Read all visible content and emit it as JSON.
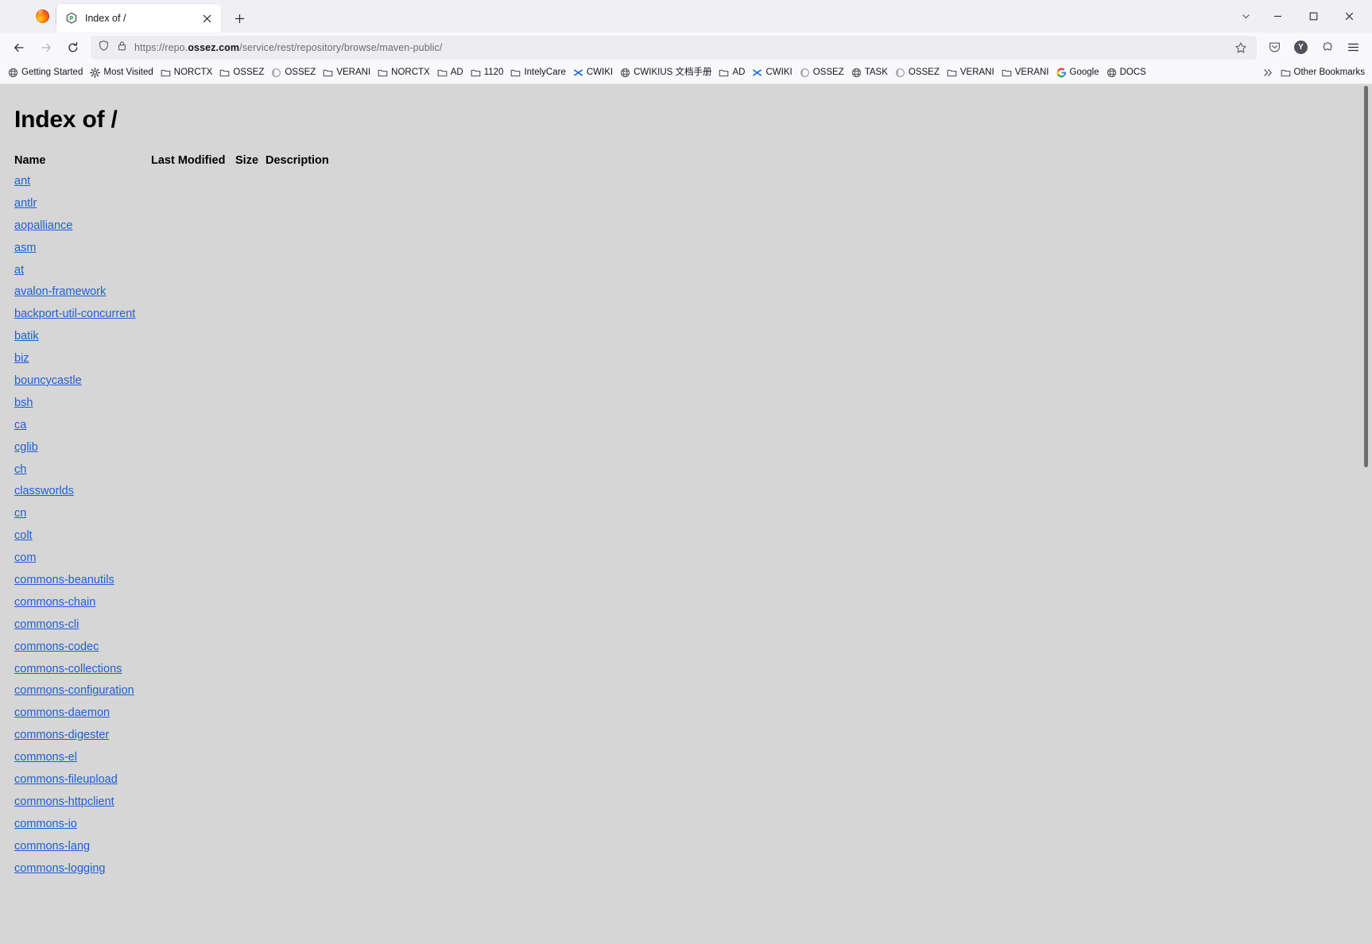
{
  "window": {
    "controls": {
      "tab_list_label": "List all tabs",
      "minimize_label": "Minimize",
      "maximize_label": "Maximize",
      "close_label": "Close"
    }
  },
  "tabstrip": {
    "tabs": [
      {
        "title": "Index of /",
        "favicon": "package-icon",
        "close_label": "Close tab"
      }
    ],
    "new_tab_label": "New tab"
  },
  "navbar": {
    "back_label": "Go back one page",
    "forward_label": "Go forward one page",
    "reload_label": "Reload current page",
    "url_prefix": "https://repo.",
    "url_domain": "ossez.com",
    "url_suffix": "/service/rest/repository/browse/maven-public/",
    "url_full": "https://repo.ossez.com/service/rest/repository/browse/maven-public/",
    "shield_label": "Tracking protection",
    "lock_label": "Secure connection",
    "star_label": "Bookmark this page",
    "pocket_label": "Save to Pocket",
    "account_initial": "Y",
    "account_label": "Account",
    "extensions_label": "Extensions",
    "menu_label": "Open application menu"
  },
  "bookmarks": {
    "items": [
      {
        "label": "Getting Started",
        "icon": "globe-icon"
      },
      {
        "label": "Most Visited",
        "icon": "gear-icon"
      },
      {
        "label": "NORCTX",
        "icon": "folder-icon"
      },
      {
        "label": "OSSEZ",
        "icon": "folder-icon"
      },
      {
        "label": "OSSEZ",
        "icon": "circle-icon"
      },
      {
        "label": "VERANI",
        "icon": "folder-icon"
      },
      {
        "label": "NORCTX",
        "icon": "folder-icon"
      },
      {
        "label": "AD",
        "icon": "folder-icon"
      },
      {
        "label": "1120",
        "icon": "folder-icon"
      },
      {
        "label": "IntelyCare",
        "icon": "folder-icon"
      },
      {
        "label": "CWIKI",
        "icon": "cwiki-icon"
      },
      {
        "label": "CWIKIUS 文档手册",
        "icon": "globe-icon"
      },
      {
        "label": "AD",
        "icon": "folder-icon"
      },
      {
        "label": "CWIKI",
        "icon": "cwiki-icon"
      },
      {
        "label": "OSSEZ",
        "icon": "circle-icon"
      },
      {
        "label": "TASK",
        "icon": "globe-icon"
      },
      {
        "label": "OSSEZ",
        "icon": "circle-icon"
      },
      {
        "label": "VERANI",
        "icon": "folder-icon"
      },
      {
        "label": "VERANI",
        "icon": "folder-icon"
      },
      {
        "label": "Google",
        "icon": "google-icon"
      },
      {
        "label": "DOCS",
        "icon": "globe-icon"
      }
    ],
    "overflow_label": "≫",
    "other_bookmarks": {
      "label": "Other Bookmarks",
      "icon": "folder-icon"
    }
  },
  "page": {
    "title": "Index of /",
    "columns": [
      "Name",
      "Last Modified",
      "Size",
      "Description"
    ],
    "entries": [
      {
        "name": "ant",
        "modified": "",
        "size": "",
        "description": ""
      },
      {
        "name": "antlr",
        "modified": "",
        "size": "",
        "description": ""
      },
      {
        "name": "aopalliance",
        "modified": "",
        "size": "",
        "description": ""
      },
      {
        "name": "asm",
        "modified": "",
        "size": "",
        "description": ""
      },
      {
        "name": "at",
        "modified": "",
        "size": "",
        "description": ""
      },
      {
        "name": "avalon-framework",
        "modified": "",
        "size": "",
        "description": ""
      },
      {
        "name": "backport-util-concurrent",
        "modified": "",
        "size": "",
        "description": ""
      },
      {
        "name": "batik",
        "modified": "",
        "size": "",
        "description": ""
      },
      {
        "name": "biz",
        "modified": "",
        "size": "",
        "description": ""
      },
      {
        "name": "bouncycastle",
        "modified": "",
        "size": "",
        "description": ""
      },
      {
        "name": "bsh",
        "modified": "",
        "size": "",
        "description": ""
      },
      {
        "name": "ca",
        "modified": "",
        "size": "",
        "description": ""
      },
      {
        "name": "cglib",
        "modified": "",
        "size": "",
        "description": ""
      },
      {
        "name": "ch",
        "modified": "",
        "size": "",
        "description": ""
      },
      {
        "name": "classworlds",
        "modified": "",
        "size": "",
        "description": ""
      },
      {
        "name": "cn",
        "modified": "",
        "size": "",
        "description": ""
      },
      {
        "name": "colt",
        "modified": "",
        "size": "",
        "description": ""
      },
      {
        "name": "com",
        "modified": "",
        "size": "",
        "description": ""
      },
      {
        "name": "commons-beanutils",
        "modified": "",
        "size": "",
        "description": ""
      },
      {
        "name": "commons-chain",
        "modified": "",
        "size": "",
        "description": ""
      },
      {
        "name": "commons-cli",
        "modified": "",
        "size": "",
        "description": ""
      },
      {
        "name": "commons-codec",
        "modified": "",
        "size": "",
        "description": ""
      },
      {
        "name": "commons-collections",
        "modified": "",
        "size": "",
        "description": ""
      },
      {
        "name": "commons-configuration",
        "modified": "",
        "size": "",
        "description": ""
      },
      {
        "name": "commons-daemon",
        "modified": "",
        "size": "",
        "description": ""
      },
      {
        "name": "commons-digester",
        "modified": "",
        "size": "",
        "description": ""
      },
      {
        "name": "commons-el",
        "modified": "",
        "size": "",
        "description": ""
      },
      {
        "name": "commons-fileupload",
        "modified": "",
        "size": "",
        "description": ""
      },
      {
        "name": "commons-httpclient",
        "modified": "",
        "size": "",
        "description": ""
      },
      {
        "name": "commons-io",
        "modified": "",
        "size": "",
        "description": ""
      },
      {
        "name": "commons-lang",
        "modified": "",
        "size": "",
        "description": ""
      },
      {
        "name": "commons-logging",
        "modified": "",
        "size": "",
        "description": ""
      }
    ]
  },
  "colors": {
    "page_background": "#d6d6d6",
    "link": "#1f5fd0",
    "chrome_background": "#f9f9fb",
    "tabstrip_background": "#f0f0f4",
    "urlbar_background": "#ededf0",
    "text": "#15141a"
  }
}
